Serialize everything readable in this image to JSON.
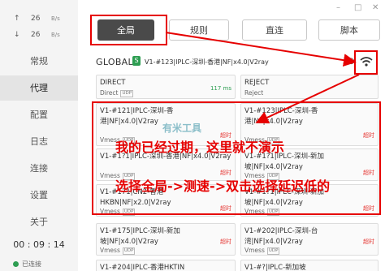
{
  "sidebar": {
    "upload_speed": {
      "arrow": "↑",
      "value": "26",
      "unit": "B/s"
    },
    "download_speed": {
      "arrow": "↓",
      "value": "26",
      "unit": "B/s"
    },
    "nav": [
      {
        "label": "常规"
      },
      {
        "label": "代理",
        "active": true
      },
      {
        "label": "配置"
      },
      {
        "label": "日志"
      },
      {
        "label": "连接"
      },
      {
        "label": "设置"
      },
      {
        "label": "关于"
      }
    ],
    "timer": "00 : 09 : 14",
    "status_text": "已连接"
  },
  "window_controls": {
    "minimize": "–",
    "maximize": "□",
    "close": "✕"
  },
  "mode_tabs": [
    {
      "label": "全局",
      "active": true
    },
    {
      "label": "规则"
    },
    {
      "label": "直连"
    },
    {
      "label": "脚本"
    }
  ],
  "group": {
    "name": "GLOBAL",
    "badge": "S",
    "current": "V1-#123|IPLC-深圳-香港|NF|x4.0|V2ray"
  },
  "proxies": [
    {
      "name": "DIRECT",
      "type": "Direct",
      "tag": "UDP",
      "delay": "117 ms",
      "delay_ok": true
    },
    {
      "name": "REJECT",
      "type": "Reject",
      "tag": "",
      "delay": ""
    },
    {
      "name": "V1-#121|IPLC-深圳-香港|NF|x4.0|V2ray",
      "type": "Vmess",
      "tag": "UDP",
      "delay": "超时"
    },
    {
      "name": "V1-#123|IPLC-深圳-香港|NF|x4.0|V2ray",
      "type": "Vmess",
      "tag": "UDP",
      "delay": "超时"
    },
    {
      "name": "V1-#1?1|IPLC-深圳-香港|NF|x4.0|V2ray",
      "type": "Vmess",
      "tag": "UDP",
      "delay": "超时"
    },
    {
      "name": "V1-#1?1|IPLC-深圳-新加坡|NF|x4.0|V2ray",
      "type": "Vmess",
      "tag": "UDP",
      "delay": "超时"
    },
    {
      "name": "V1-#171|CN2-香港HKBN|NF|x2.0|V2ray",
      "type": "Vmess",
      "tag": "UDP",
      "delay": "超时"
    },
    {
      "name": "V1-#1?1|IPLC-深圳-新加坡|NF|x4.0|V2ray",
      "type": "Vmess",
      "tag": "UDP",
      "delay": "超时"
    },
    {
      "name": "V1-#175|IPLC-深圳-新加坡|NF|x4.0|V2ray",
      "type": "Vmess",
      "tag": "UDP",
      "delay": "超时"
    },
    {
      "name": "V1-#202|IPLC-深圳-台湾|NF|x4.0|V2ray",
      "type": "Vmess",
      "tag": "UDP",
      "delay": "超时"
    },
    {
      "name": "V1-#204|IPLC-香港HKTIN",
      "type": "",
      "tag": "",
      "delay": ""
    },
    {
      "name": "V1-#?|IPLC-新加坡",
      "type": "",
      "tag": "",
      "delay": ""
    }
  ],
  "annotations": {
    "line1": "我的已经过期，这里就不演示",
    "line2": "选择全局->测速->双击选择延迟低的"
  },
  "watermark": "有米工具",
  "colors": {
    "accent_red": "#e60000",
    "active_tab": "#4a4a4a",
    "status_green": "#2e9e52",
    "timeout_red": "#e53935"
  }
}
